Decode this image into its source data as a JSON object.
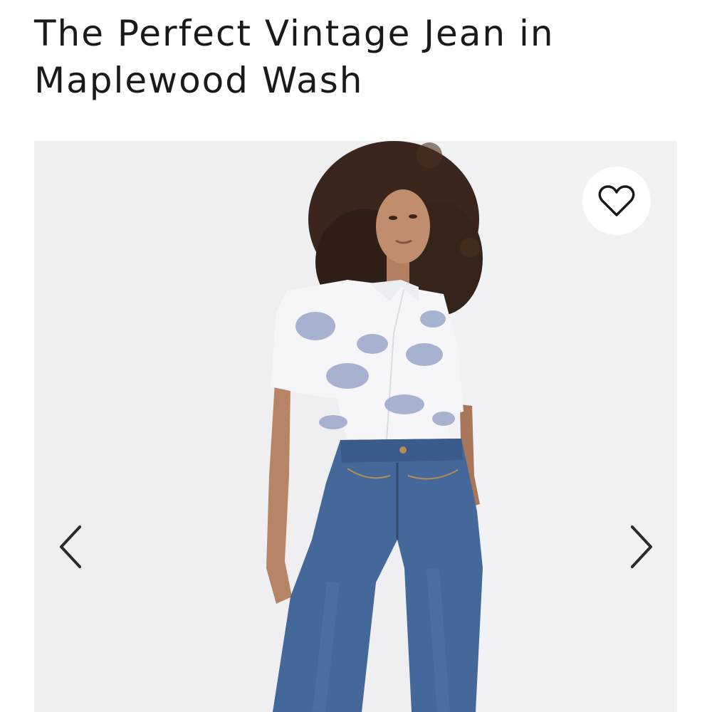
{
  "product": {
    "title": "The Perfect Vintage Jean in Maplewood Wash"
  },
  "gallery": {
    "favorite_icon": "heart-icon",
    "prev_icon": "chevron-left-icon",
    "next_icon": "chevron-right-icon"
  }
}
